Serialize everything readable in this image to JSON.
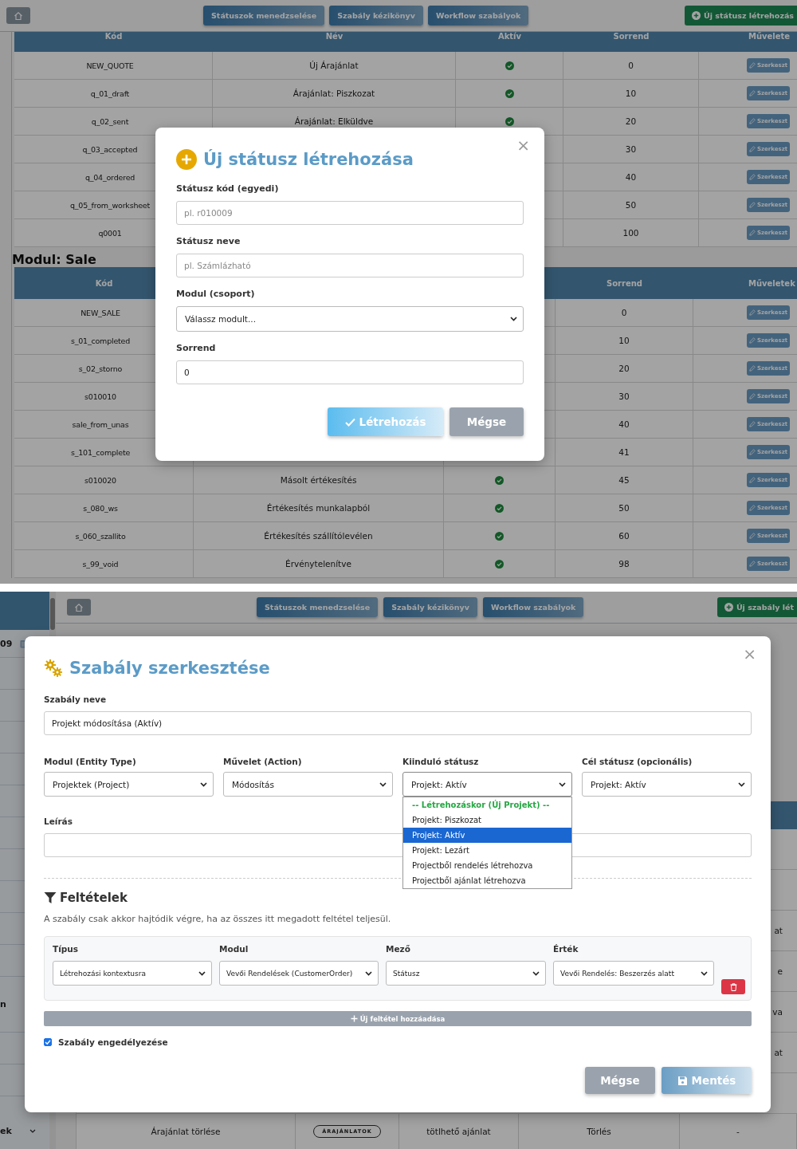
{
  "status_screen": {
    "header": {
      "nav": [
        "Státuszok menedzselése",
        "Szabály kézikönyv",
        "Workflow szabályok"
      ],
      "new_button": "Új státusz létrehozás"
    },
    "tables": [
      {
        "columns": {
          "code": "Kód",
          "name": "Név",
          "active": "Aktív",
          "order": "Sorrend",
          "actions": "Művelete"
        },
        "rows": [
          {
            "code": "NEW_QUOTE",
            "name": "Új Árajánlat",
            "active": true,
            "order": "0",
            "action": "Szerkeszt"
          },
          {
            "code": "q_01_draft",
            "name": "Árajánlat: Piszkozat",
            "active": true,
            "order": "10",
            "action": "Szerkeszt"
          },
          {
            "code": "q_02_sent",
            "name": "Árajánlat: Elküldve",
            "active": true,
            "order": "20",
            "action": "Szerkeszt"
          },
          {
            "code": "q_03_accepted",
            "order": "30",
            "action": "Szerkeszt"
          },
          {
            "code": "q_04_ordered",
            "order": "40",
            "action": "Szerkeszt"
          },
          {
            "code": "q_05_from_worksheet",
            "order": "50",
            "action": "Szerkeszt"
          },
          {
            "code": "q0001",
            "order": "100",
            "action": "Szerkeszt"
          }
        ]
      },
      {
        "title": "Modul: Sale",
        "columns": {
          "code": "Kód",
          "order": "Sorrend",
          "actions": "Műveletek"
        },
        "rows": [
          {
            "code": "NEW_SALE",
            "order": "0",
            "action": "Szerkeszt"
          },
          {
            "code": "s_01_completed",
            "order": "10",
            "action": "Szerkeszt"
          },
          {
            "code": "s_02_storno",
            "order": "20",
            "action": "Szerkeszt"
          },
          {
            "code": "s010010",
            "order": "30",
            "action": "Szerkeszt"
          },
          {
            "code": "sale_from_unas",
            "order": "40",
            "action": "Szerkeszt"
          },
          {
            "code": "s_101_complete",
            "order": "41",
            "action": "Szerkeszt"
          },
          {
            "code": "s010020",
            "name": "Másolt értékesítés",
            "active": true,
            "order": "45",
            "action": "Szerkeszt"
          },
          {
            "code": "s_080_ws",
            "name": "Értékesítés munkalapból",
            "active": true,
            "order": "50",
            "action": "Szerkeszt"
          },
          {
            "code": "s_060_szallito",
            "name": "Értékesítés szállítólevélen",
            "active": true,
            "order": "60",
            "action": "Szerkeszt"
          },
          {
            "code": "s_99_void",
            "name": "Érvénytelenítve",
            "active": true,
            "order": "98",
            "action": "Szerkeszt"
          }
        ]
      }
    ],
    "modal": {
      "title": "Új státusz létrehozása",
      "close": "×",
      "fields": [
        {
          "label": "Státusz kód (egyedi)",
          "kind": "text",
          "placeholder": "pl. r010009"
        },
        {
          "label": "Státusz neve",
          "kind": "text",
          "placeholder": "pl. Számlázható"
        },
        {
          "label": "Modul (csoport)",
          "kind": "select",
          "value": "Válassz modult..."
        },
        {
          "label": "Sorrend",
          "kind": "text",
          "value": "0"
        }
      ],
      "buttons": [
        {
          "label": "Létrehozás",
          "kind": "primary"
        },
        {
          "label": "Mégse",
          "kind": "secondary"
        }
      ]
    }
  },
  "rule_screen": {
    "sidebar": {
      "date_fragment": "09",
      "item_fragment": "n",
      "group_fragment": "ek"
    },
    "header": {
      "nav": [
        "Státuszok menedzselése",
        "Szabály kézikönyv",
        "Workflow szabályok"
      ],
      "new_button": "Új szabály lét"
    },
    "table": {
      "right_fragments": [
        "at",
        "e",
        "va",
        "at"
      ],
      "last_row": [
        {
          "text": "Árajánlat törlése",
          "kind": "text"
        },
        {
          "text": "ÁRAJÁNLATOK",
          "kind": "badge"
        },
        {
          "text": "tötlhető ajánlat",
          "kind": "text"
        },
        {
          "text": "Törlés",
          "kind": "text"
        },
        {
          "text": "-",
          "kind": "text"
        }
      ]
    },
    "modal": {
      "title": "Szabály szerkesztése",
      "close": "×",
      "name_field": {
        "label": "Szabály neve",
        "value": "Projekt módosítása (Aktív)"
      },
      "selects": [
        {
          "label": "Modul (Entity Type)",
          "value": "Projektek (Project)",
          "expanded": false
        },
        {
          "label": "Művelet (Action)",
          "value": "Módosítás",
          "expanded": false
        },
        {
          "label": "Kiinduló státusz",
          "value": "Projekt: Aktív",
          "expanded": true,
          "options": [
            {
              "label": "-- Létrehozáskor (Új Projekt) --",
              "kind": "group",
              "selected": false
            },
            {
              "label": "Projekt: Piszkozat",
              "kind": "option",
              "selected": false
            },
            {
              "label": "Projekt: Aktív",
              "kind": "option",
              "selected": true
            },
            {
              "label": "Projekt: Lezárt",
              "kind": "option",
              "selected": false
            },
            {
              "label": "Projectből rendelés létrehozva",
              "kind": "option",
              "selected": false
            },
            {
              "label": "Projectből ajánlat létrehozva",
              "kind": "option",
              "selected": false
            }
          ]
        },
        {
          "label": "Cél státusz (opcionális)",
          "value": "Projekt: Aktív",
          "expanded": false
        }
      ],
      "description_field": {
        "label": "Leírás"
      },
      "conditions": {
        "title": "Feltételek",
        "hint": "A szabály csak akkor hajtódik végre, ha az összes itt megadott feltétel teljesül.",
        "rows": [
          {
            "fields": [
              {
                "label": "Típus",
                "value": "Létrehozási kontextusra"
              },
              {
                "label": "Modul",
                "value": "Vevői Rendelések (CustomerOrder)"
              },
              {
                "label": "Mező",
                "value": "Státusz"
              },
              {
                "label": "Érték",
                "value": "Vevői Rendelés: Beszerzés alatt"
              }
            ]
          }
        ],
        "add_button": "Új feltétel hozzáadása"
      },
      "enabled": {
        "label": "Szabály engedélyezése",
        "checked": true
      },
      "buttons": [
        {
          "label": "Mégse",
          "kind": "secondary"
        },
        {
          "label": "Mentés",
          "kind": "save"
        }
      ]
    }
  }
}
